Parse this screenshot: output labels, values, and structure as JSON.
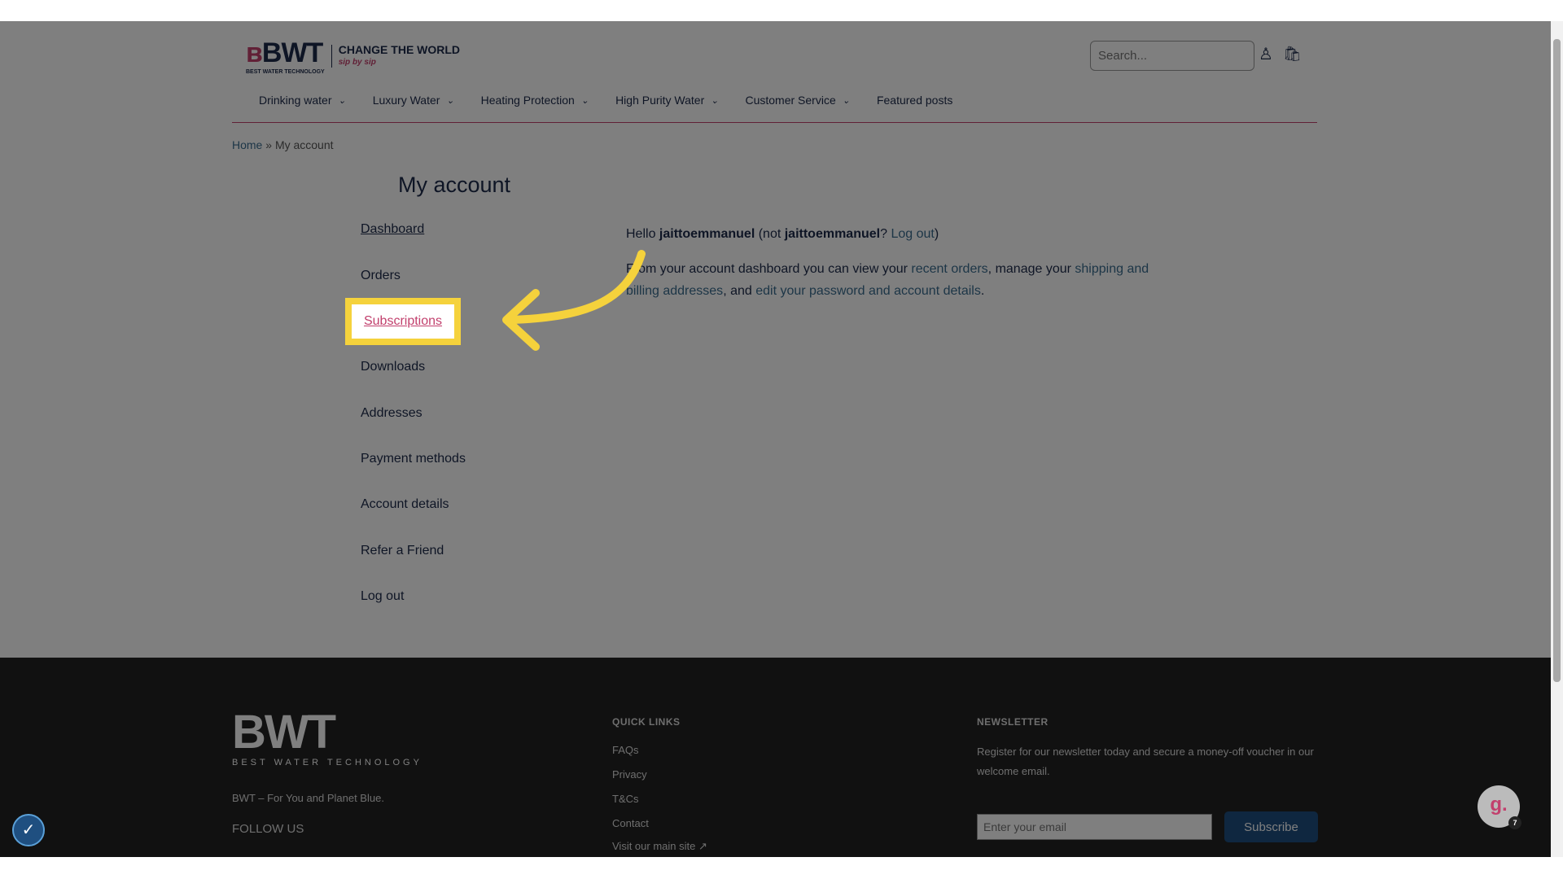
{
  "header": {
    "logo": "BWT",
    "logo_sub": "BEST WATER TECHNOLOGY",
    "campaign": "CHANGE THE WORLD",
    "campaign_tag": "sip by sip",
    "search_placeholder": "Search...",
    "nav": [
      {
        "label": "Drinking water",
        "dropdown": true
      },
      {
        "label": "Luxury Water",
        "dropdown": true
      },
      {
        "label": "Heating Protection",
        "dropdown": true
      },
      {
        "label": "High Purity Water",
        "dropdown": true
      },
      {
        "label": "Customer Service",
        "dropdown": true
      },
      {
        "label": "Featured posts",
        "dropdown": false
      }
    ]
  },
  "breadcrumb": {
    "home": "Home",
    "sep": " » ",
    "current": "My account"
  },
  "page_title": "My account",
  "sidebar": [
    "Dashboard",
    "Orders",
    "Subscriptions",
    "Downloads",
    "Addresses",
    "Payment methods",
    "Account details",
    "Refer a Friend",
    "Log out"
  ],
  "content": {
    "hello": "Hello ",
    "user": "jaittoemmanuel",
    "not": " (not ",
    "user2": "jaittoemmanuel",
    "q": "? ",
    "logout": "Log out",
    "close": ")",
    "p1": "From your account dashboard you can view your ",
    "recent_orders": "recent orders",
    "p2": ", manage your ",
    "shipping": "shipping and billing addresses",
    "p3": ", and ",
    "edit": "edit your password and account details",
    "p4": "."
  },
  "footer": {
    "logo": "BWT",
    "logo_sub": "BEST WATER TECHNOLOGY",
    "tagline": "BWT – For You and Planet Blue.",
    "follow": "FOLLOW US",
    "quick_links_title": "QUICK LINKS",
    "quick_links": [
      "FAQs",
      "Privacy",
      "T&Cs",
      "Contact",
      "Visit our main site ↗"
    ],
    "newsletter_title": "NEWSLETTER",
    "newsletter_text": "Register for our newsletter today and secure a money-off voucher in our welcome email.",
    "email_placeholder": "Enter your email",
    "subscribe": "Subscribe"
  },
  "chat_badge": "7",
  "colors": {
    "highlight": "#f5d23c",
    "accent": "#c2406d",
    "navy": "#1d2a4a"
  }
}
